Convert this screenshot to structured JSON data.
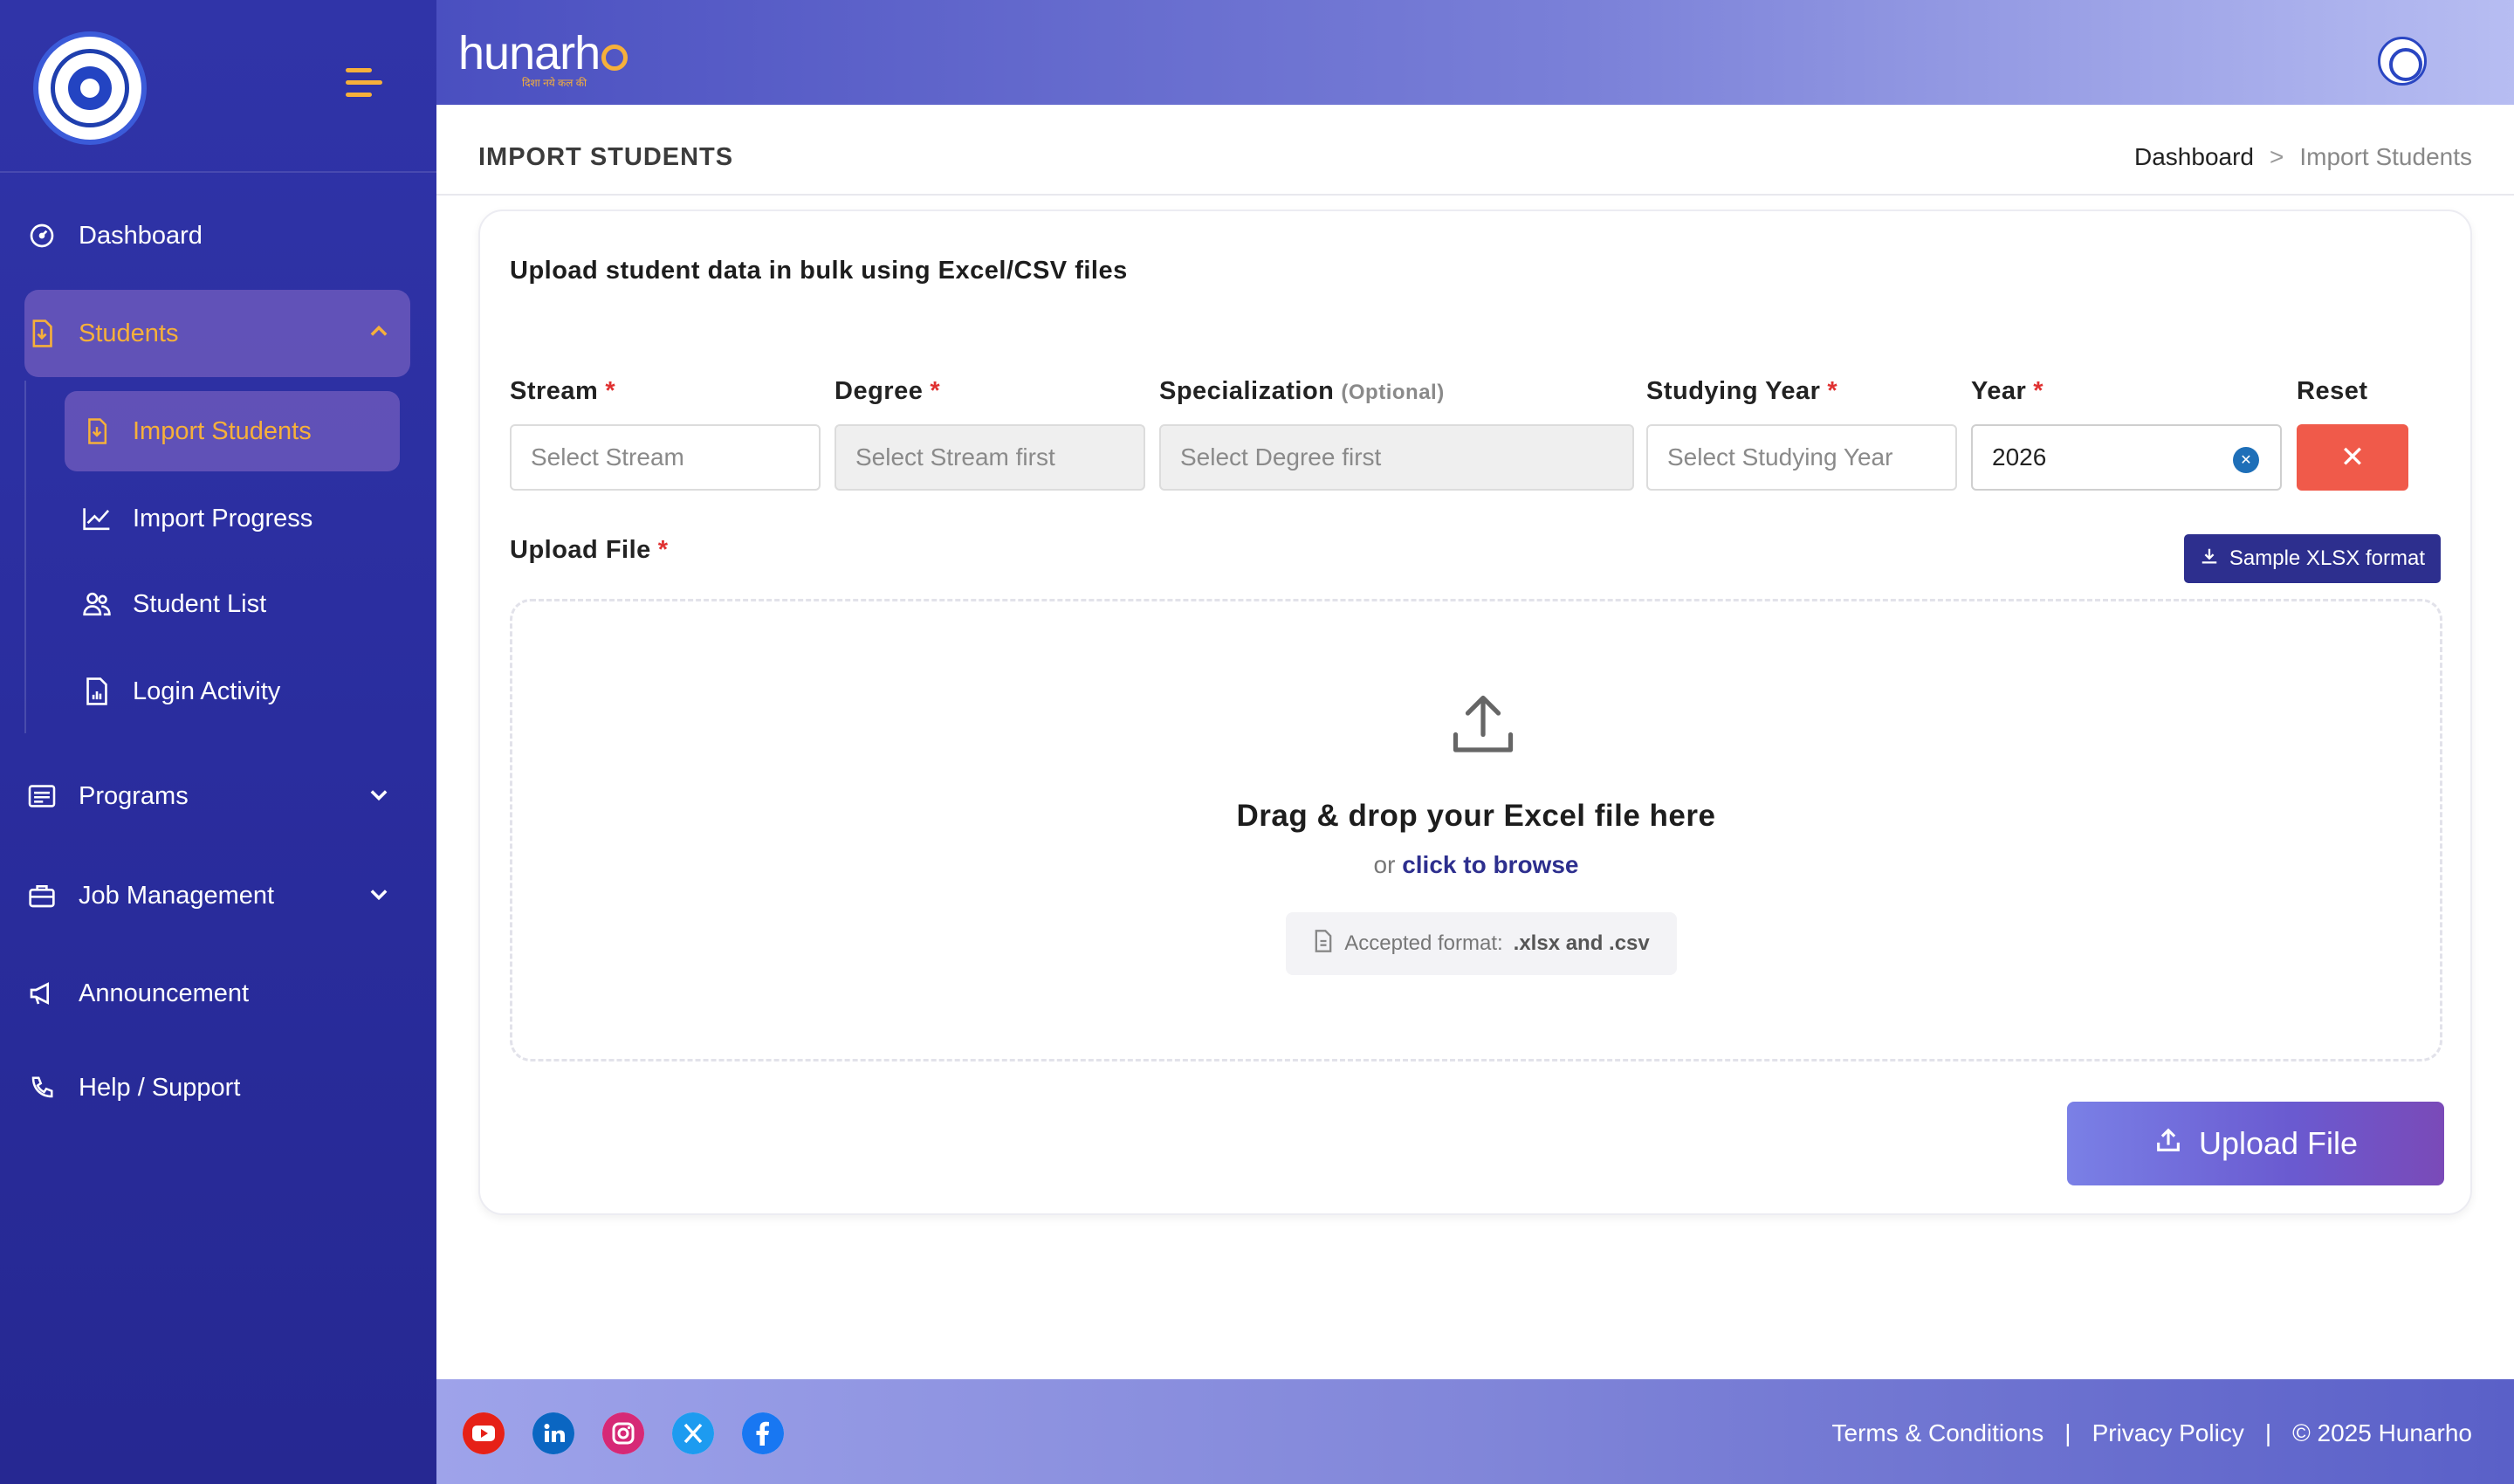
{
  "sidebar": {
    "nav": {
      "dashboard": "Dashboard",
      "students": "Students",
      "programs": "Programs",
      "job_management": "Job Management",
      "announcement": "Announcement",
      "help": "Help / Support"
    },
    "students_sub": {
      "import_students": "Import Students",
      "import_progress": "Import Progress",
      "student_list": "Student List",
      "login_activity": "Login Activity"
    }
  },
  "header": {
    "brand": "hunarh",
    "brand_tagline": "दिशा नये कल की"
  },
  "page": {
    "title": "IMPORT STUDENTS",
    "breadcrumb": {
      "home": "Dashboard",
      "separator": ">",
      "current": "Import Students"
    }
  },
  "form": {
    "heading": "Upload student data in bulk using Excel/CSV files",
    "required_mark": "*",
    "stream": {
      "label": "Stream",
      "placeholder": "Select Stream"
    },
    "degree": {
      "label": "Degree",
      "placeholder": "Select Stream first"
    },
    "specialization": {
      "label": "Specialization",
      "optional": "(Optional)",
      "placeholder": "Select Degree first"
    },
    "studying_year": {
      "label": "Studying Year",
      "placeholder": "Select Studying Year"
    },
    "year": {
      "label": "Year",
      "value": "2026"
    },
    "reset": {
      "label": "Reset"
    },
    "upload_file_label": "Upload File",
    "sample_button": "Sample XLSX format",
    "dropzone": {
      "title": "Drag & drop your Excel file here",
      "or": "or",
      "browse": "click to browse",
      "format_label": "Accepted format:",
      "format_value": ".xlsx and .csv"
    },
    "upload_button": "Upload File"
  },
  "footer": {
    "terms": "Terms & Conditions",
    "privacy": "Privacy Policy",
    "separator": "|",
    "copyright": "© 2025 Hunarho"
  },
  "colors": {
    "sidebar": "#2a2d9e",
    "accent": "#f6b03a",
    "primary_button": "#2d2f8e",
    "reset_button": "#f05a4a"
  }
}
